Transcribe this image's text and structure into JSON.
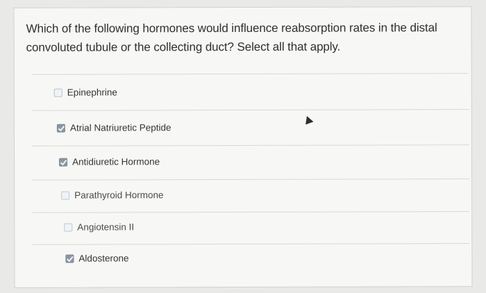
{
  "question": {
    "text": "Which of the following hormones would influence reabsorption rates in the distal convoluted tubule or the collecting duct? Select all that apply."
  },
  "options": [
    {
      "label": "Epinephrine",
      "checked": false
    },
    {
      "label": "Atrial Natriuretic Peptide",
      "checked": true
    },
    {
      "label": "Antidiuretic Hormone",
      "checked": true
    },
    {
      "label": "Parathyroid Hormone",
      "checked": false
    },
    {
      "label": "Angiotensin II",
      "checked": false
    },
    {
      "label": "Aldosterone",
      "checked": true
    }
  ],
  "icons": {
    "checked": "checkbox-checked-icon",
    "unchecked": "checkbox-unchecked-icon",
    "cursor": "mouse-cursor-icon"
  },
  "colors": {
    "background": "#e9e9e7",
    "card": "#f7f7f5",
    "text": "#2f2f2f",
    "checked_box": "#8b97a3",
    "unchecked_box": "#eef3f7",
    "divider": "#d8d8d5"
  }
}
